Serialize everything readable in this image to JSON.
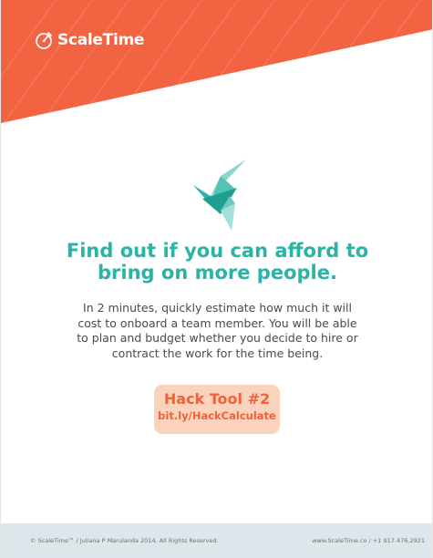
{
  "brand": {
    "name": "ScaleTime",
    "logo_icon": "stopwatch-icon",
    "accent_orange": "#f26441",
    "teal": "#2ab3a6"
  },
  "hero": {
    "illustration": "origami-bird-icon",
    "headline": "Find out if you can afford to\nbring on more people.",
    "body": "In 2 minutes, quickly estimate how much it will\ncost to onboard a team member.  You will be able\nto plan and budget whether you decide to hire or\ncontract the work for the time being."
  },
  "hack_tool": {
    "title": "Hack Tool #2",
    "link": "bit.ly/HackCalculate",
    "background": "#fbd3bd"
  },
  "footer": {
    "copyright": "© ScaleTime™ / Juliana P Marulanda 2014. All Rights Reserved.",
    "contact": "www.ScaleTime.co  /  +1 917.476.2921"
  }
}
